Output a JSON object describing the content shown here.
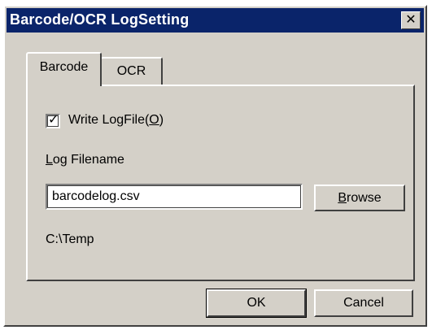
{
  "window": {
    "title": "Barcode/OCR LogSetting",
    "close_glyph": "✕"
  },
  "tabs": [
    {
      "label": "Barcode",
      "selected": true
    },
    {
      "label": "OCR",
      "selected": false
    }
  ],
  "barcode_tab": {
    "write_logfile": {
      "checked": true,
      "check_glyph": "✓",
      "label_prefix": "Write LogFile(",
      "label_mnemonic": "O",
      "label_suffix": ")"
    },
    "log_filename_label": {
      "mnemonic": "L",
      "rest": "og Filename"
    },
    "log_filename_value": "barcodelog.csv",
    "browse_button": {
      "mnemonic": "B",
      "rest": "rowse"
    },
    "path_text": "C:\\Temp"
  },
  "buttons": {
    "ok": "OK",
    "cancel": "Cancel"
  },
  "colors": {
    "titlebar": "#0a246a",
    "face": "#d4d0c8"
  }
}
